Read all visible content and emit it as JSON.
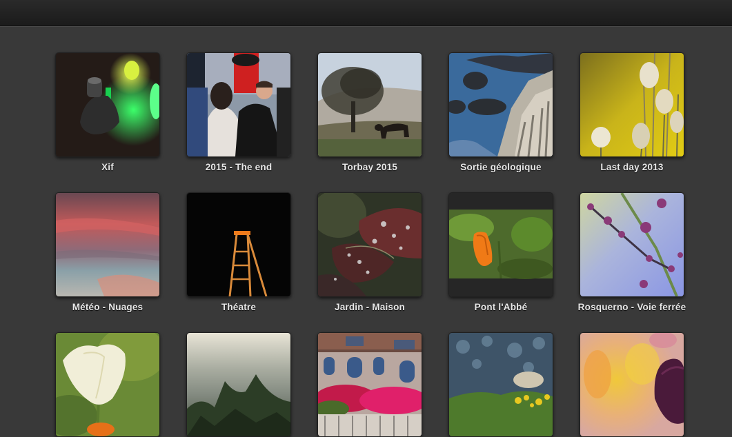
{
  "albums": [
    {
      "title": "Xif",
      "icon": "album-cover-leds-photo"
    },
    {
      "title": "2015 - The end",
      "icon": "album-cover-party-photo"
    },
    {
      "title": "Torbay 2015",
      "icon": "album-cover-tree-horse-photo"
    },
    {
      "title": "Sortie géologique",
      "icon": "album-cover-coast-rocks-photo"
    },
    {
      "title": "Last day 2013",
      "icon": "album-cover-grass-flowers-photo"
    },
    {
      "title": "Météo - Nuages",
      "icon": "album-cover-clouds-photo"
    },
    {
      "title": "Théatre",
      "icon": "album-cover-ladder-stage-photo"
    },
    {
      "title": "Jardin - Maison",
      "icon": "album-cover-dew-leaves-photo"
    },
    {
      "title": "Pont l'Abbé",
      "icon": "album-cover-orange-bud-photo"
    },
    {
      "title": "Rosquerno - Voie ferrée",
      "icon": "album-cover-buds-branch-photo"
    },
    {
      "title": "",
      "icon": "album-cover-poppy-photo"
    },
    {
      "title": "",
      "icon": "album-cover-trees-fog-photo"
    },
    {
      "title": "",
      "icon": "album-cover-building-flowers-photo"
    },
    {
      "title": "",
      "icon": "album-cover-meadow-bokeh-photo"
    },
    {
      "title": "",
      "icon": "album-cover-tulip-photo"
    }
  ]
}
